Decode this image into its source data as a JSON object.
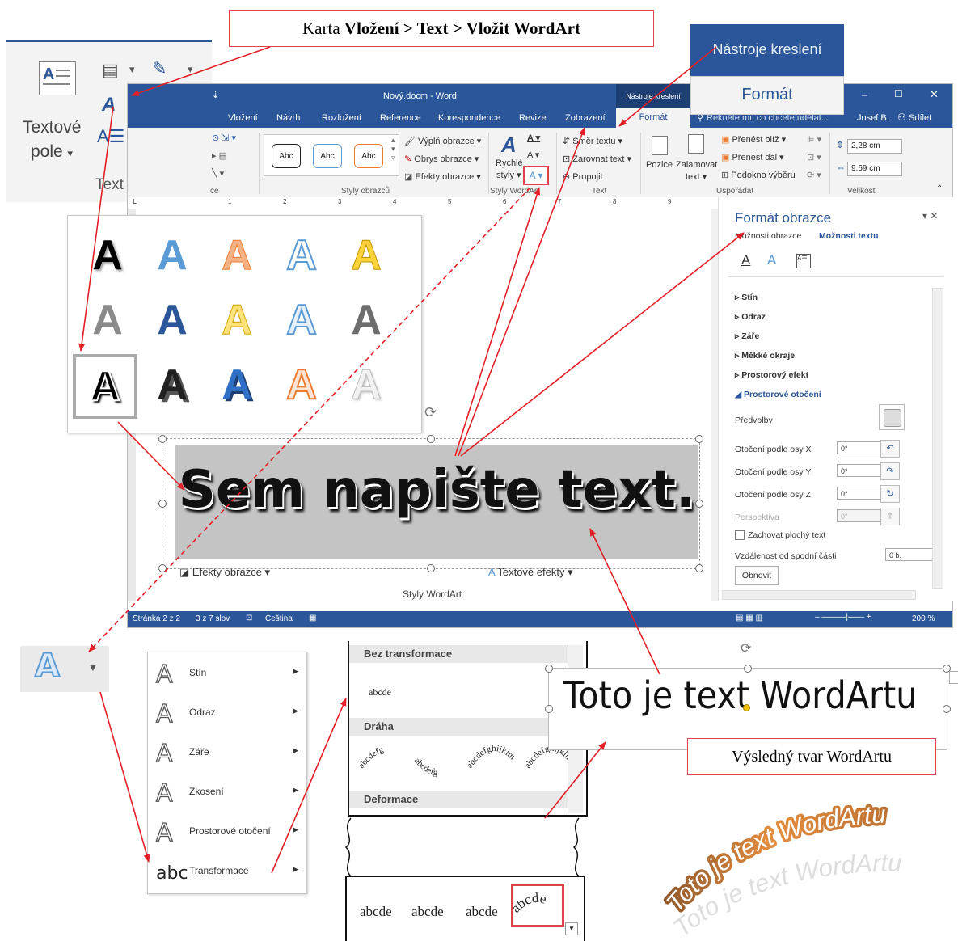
{
  "callouts": {
    "insert_wordart_prefix": "Karta ",
    "insert_wordart_bold": "Vložení > Text > Vložit WordArt",
    "result_shape": "Výsledný tvar WordArtu"
  },
  "text_ribbon": {
    "textbox_line1": "Textové",
    "textbox_line2": "pole",
    "dropdown": "▾",
    "group_label": "Text"
  },
  "drawing_tools": {
    "title": "Nástroje kreslení",
    "format_tab": "Formát"
  },
  "word": {
    "quick_access_arrow": "⇣",
    "title": "Nový.docm - Word",
    "context_title": "Nástroje kreslení",
    "min": "–",
    "max": "☐",
    "close": "✕",
    "tabs": [
      "Vložení",
      "Návrh",
      "Rozložení",
      "Reference",
      "Korespondence",
      "Revize",
      "Zobrazení",
      "Formát"
    ],
    "search": "Řekněte mi, co chcete udělat...",
    "user": "Josef B.",
    "share": "Sdílet",
    "ribbon": {
      "frag_label": "ce",
      "style_abc": "Abc",
      "fill": "Výplň obrazce",
      "outline": "Obrys obrazce",
      "effects": "Efekty obrazce",
      "styles_group": "Styly obrazců",
      "quick": "Rychlé",
      "styles": "styly",
      "wordart_group": "Styly WordArt",
      "direction": "Směr textu",
      "align": "Zarovnat text",
      "link": "Propojit",
      "text_group": "Text",
      "position": "Pozice",
      "wrap_line1": "Zalamovat",
      "wrap_line2": "text",
      "forward": "Přenést blíž",
      "backward": "Přenést dál",
      "pane": "Podokno výběru",
      "arrange_group": "Uspořádat",
      "height": "2,28 cm",
      "width": "9,69 cm",
      "size_group": "Velikost"
    },
    "ruler_marks": [
      "L",
      "1",
      "2",
      "3",
      "4",
      "5",
      "6",
      "7",
      "8",
      "9"
    ],
    "inner_effects": "Efekty obrazce",
    "inner_text_effects": "Textové efekty",
    "inner_wordart_styles": "Styly WordArt",
    "status": {
      "page": "Stránka 2 z 2",
      "words": "3 z 7 slov",
      "language": "Čeština",
      "zoom": "200 %"
    }
  },
  "format_pane": {
    "title": "Formát obrazce",
    "opt_shape": "Možnosti obrazce",
    "opt_text": "Možnosti textu",
    "sections": [
      "Stín",
      "Odraz",
      "Záře",
      "Měkké okraje",
      "Prostorový efekt",
      "Prostorové otočení"
    ],
    "presets": "Předvolby",
    "rot_x": "Otočení podle osy X",
    "rot_y": "Otočení podle osy Y",
    "rot_z": "Otočení podle osy Z",
    "perspective": "Perspektiva",
    "deg": "0°",
    "flat_text": "Zachovat plochý text",
    "distance": "Vzdálenost od spodní části",
    "distance_val": "0 b.",
    "reset": "Obnovit"
  },
  "wordart_sample": "Sem napište text.",
  "effects_menu": [
    "Stín",
    "Odraz",
    "Záře",
    "Zkosení",
    "Prostorové otočení",
    "Transformace"
  ],
  "effects_glyphs": [
    "A",
    "A",
    "A",
    "A",
    "A",
    "abc"
  ],
  "transform": {
    "no_transform": "Bez transformace",
    "sample": "abcde",
    "path": "Dráha",
    "deform": "Deformace"
  },
  "deform_samples": [
    "abcde",
    "abcde",
    "abcde",
    "abcde"
  ],
  "result_text": "Toto je text WordArtu",
  "curved_text": "Toto je text WordArtu",
  "colors": {
    "word_blue": "#2b579a",
    "callout_red": "#e0414a",
    "arrow_red": "#e21f26"
  }
}
